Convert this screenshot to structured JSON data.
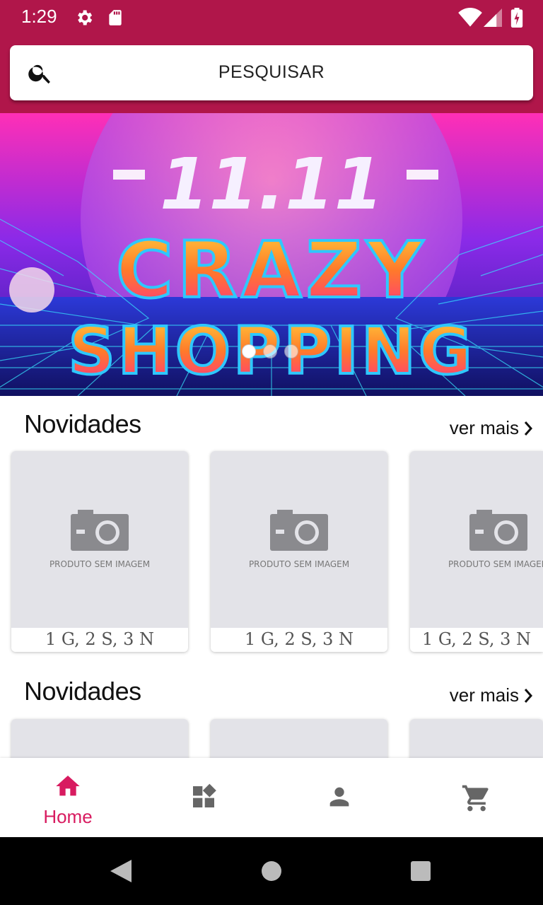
{
  "status": {
    "time": "1:29"
  },
  "search": {
    "placeholder": "PESQUISAR"
  },
  "banner": {
    "line1": "11.11",
    "line2": "CRAZY",
    "line3": "SHOPPING",
    "slides": 3,
    "active_slide": 0
  },
  "sections": [
    {
      "title": "Novidades",
      "more": "ver mais",
      "products": [
        {
          "no_image": "PRODUTO SEM IMAGEM",
          "caption": "1 G, 2 S, 3 N"
        },
        {
          "no_image": "PRODUTO SEM IMAGEM",
          "caption": "1 G, 2 S, 3 N"
        },
        {
          "no_image": "PRODUTO SEM IMAGEM",
          "caption": "1 G, 2 S, 3 N"
        }
      ]
    },
    {
      "title": "Novidades",
      "more": "ver mais"
    }
  ],
  "nav": {
    "home": "Home"
  },
  "colors": {
    "primary": "#b0164a",
    "accent": "#d81b60"
  },
  "icons": [
    "search-icon",
    "settings-icon",
    "sd-card-icon",
    "wifi-icon",
    "signal-icon",
    "battery-icon",
    "camera-icon",
    "home-icon",
    "categories-icon",
    "person-icon",
    "cart-icon"
  ]
}
